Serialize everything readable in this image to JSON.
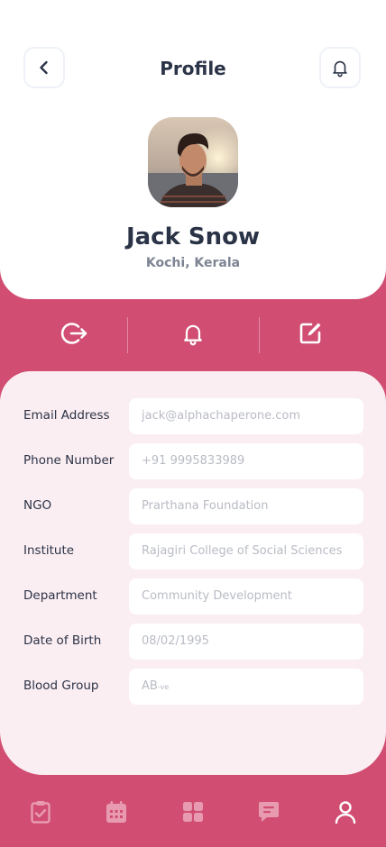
{
  "header": {
    "title": "Profile"
  },
  "profile": {
    "name": "Jack Snow",
    "location": "Kochi, Kerala"
  },
  "fields": [
    {
      "label": "Email Address",
      "value": "jack@alphachaperone.com"
    },
    {
      "label": "Phone Number",
      "value": "+91 9995833989"
    },
    {
      "label": "NGO",
      "value": "Prarthana Foundation"
    },
    {
      "label": "Institute",
      "value": "Rajagiri College of Social Sciences"
    },
    {
      "label": "Department",
      "value": "Community Development"
    },
    {
      "label": "Date of Birth",
      "value": "08/02/1995"
    },
    {
      "label": "Blood Group",
      "value": "AB",
      "value_suffix": "-ve"
    }
  ],
  "icons": {
    "back": "chevron-left-icon",
    "notification": "bell-icon",
    "logout": "logout-icon",
    "edit": "edit-icon",
    "nav": [
      "clipboard-check-icon",
      "calendar-icon",
      "grid-icon",
      "chat-icon",
      "user-icon"
    ]
  },
  "colors": {
    "accent": "#d14e72",
    "panel": "#fbeef2",
    "text": "#2b3347",
    "nav_inactive": "#e89bb0",
    "nav_active": "#ffffff"
  }
}
